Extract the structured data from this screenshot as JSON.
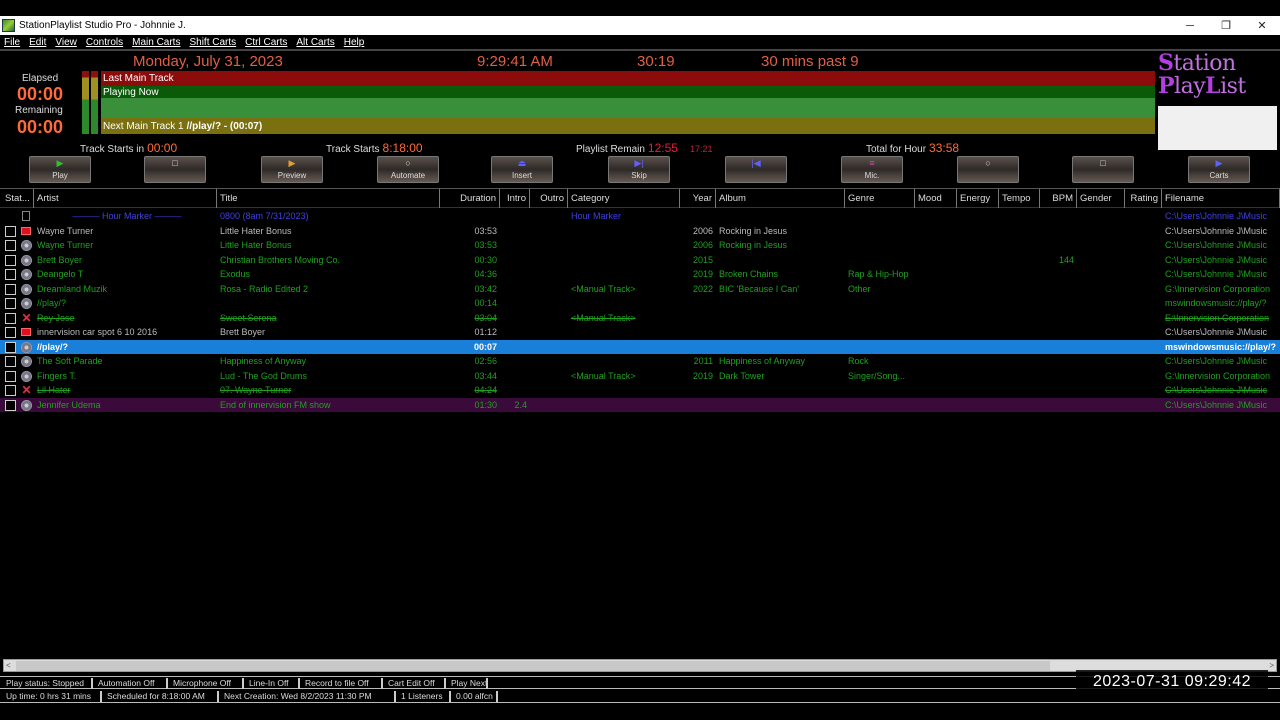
{
  "window": {
    "title": "StationPlaylist Studio Pro - Johnnie J.",
    "minimize_glyph": "─",
    "restore_glyph": "❐",
    "close_glyph": "✕"
  },
  "menu": [
    "File",
    "Edit",
    "View",
    "Controls",
    "Main Carts",
    "Shift Carts",
    "Ctrl Carts",
    "Alt Carts",
    "Help"
  ],
  "header": {
    "date": "Monday, July 31, 2023",
    "time": "9:29:41 AM",
    "countdown": "30:19",
    "mins_past": "30 mins past 9",
    "elapsed_label": "Elapsed",
    "elapsed_value": "00:00",
    "remaining_label": "Remaining",
    "remaining_value": "00:00"
  },
  "track_bars": {
    "last_main_track": "Last Main Track",
    "playing_now": "Playing Now",
    "next_label": "Next Main Track 1",
    "next_value": "//play/? -  (00:07)"
  },
  "logo": {
    "line1_cap": "S",
    "line1_rest": "tation",
    "line2_cap": "P",
    "line2_mid": "lay",
    "line2_cap2": "L",
    "line2_rest": "ist"
  },
  "info": {
    "track_starts_in_label": "Track Starts in",
    "track_starts_in_value": "00:00",
    "track_starts_label": "Track Starts",
    "track_starts_value": "8:18:00",
    "playlist_remain_label": "Playlist Remain",
    "playlist_remain_value": "12:55",
    "playlist_remain_secondary": "17:21",
    "total_for_hour_label": "Total for Hour",
    "total_for_hour_value": "33:58"
  },
  "toolbar": [
    {
      "name": "play",
      "label": "Play",
      "icon": "▶",
      "color": "#30c030"
    },
    {
      "name": "stop",
      "label": "",
      "icon": "□",
      "color": "#ddd"
    },
    {
      "name": "preview",
      "label": "Preview",
      "icon": "▶",
      "color": "#e0a030"
    },
    {
      "name": "automate",
      "label": "Automate",
      "icon": "○",
      "color": "#ddd"
    },
    {
      "name": "insert",
      "label": "Insert",
      "icon": "⏏",
      "color": "#6060ff"
    },
    {
      "name": "skip",
      "label": "Skip",
      "icon": "▶|",
      "color": "#6060ff"
    },
    {
      "name": "previous",
      "label": "",
      "icon": "|◀",
      "color": "#6060ff"
    },
    {
      "name": "mic",
      "label": "Mic.",
      "icon": "≡",
      "color": "#e040c0"
    },
    {
      "name": "record",
      "label": "",
      "icon": "○",
      "color": "#ddd"
    },
    {
      "name": "stop2",
      "label": "",
      "icon": "□",
      "color": "#ddd"
    },
    {
      "name": "carts",
      "label": "Carts",
      "icon": "▶",
      "color": "#6060ff"
    }
  ],
  "columns": [
    "Stat...",
    "Artist",
    "Title",
    "Duration",
    "Intro",
    "Outro",
    "Category",
    "Year",
    "Album",
    "Genre",
    "Mood",
    "Energy",
    "Tempo",
    "BPM",
    "Gender",
    "Rating",
    "Filename"
  ],
  "rows": [
    {
      "type": "hour-marker",
      "icon": "hour",
      "artist": "——— Hour Marker ———",
      "title": "0800 (8am 7/31/2023)",
      "duration": "",
      "intro": "",
      "category": "Hour Marker",
      "year": "",
      "album": "",
      "genre": "",
      "bpm": "",
      "filename": "C:\\Users\\Johnnie J\\Music",
      "color": "#4040e0",
      "checkbox": false
    },
    {
      "type": "normal",
      "icon": "red",
      "artist": "Wayne Turner",
      "title": "Little Hater Bonus",
      "duration": "03:53",
      "intro": "",
      "category": "",
      "year": "2006",
      "album": "Rocking in Jesus",
      "genre": "",
      "bpm": "",
      "filename": "C:\\Users\\Johnnie J\\Music",
      "color": "#bbbbbb",
      "checkbox": true
    },
    {
      "type": "normal",
      "icon": "cd",
      "artist": "Wayne Turner",
      "title": "Little Hater Bonus",
      "duration": "03:53",
      "intro": "",
      "category": "",
      "year": "2006",
      "album": "Rocking in Jesus",
      "genre": "",
      "bpm": "",
      "filename": "C:\\Users\\Johnnie J\\Music",
      "color": "#1fa01f",
      "checkbox": true
    },
    {
      "type": "normal",
      "icon": "cd",
      "artist": "Brett Boyer",
      "title": "Christian Brothers Moving Co.",
      "duration": "00:30",
      "intro": "",
      "category": "",
      "year": "2015",
      "album": "",
      "genre": "",
      "bpm": "144",
      "filename": "C:\\Users\\Johnnie J\\Music",
      "color": "#1fa01f",
      "checkbox": true
    },
    {
      "type": "normal",
      "icon": "cd",
      "artist": "Deangelo T",
      "title": "Exodus",
      "duration": "04:36",
      "intro": "",
      "category": "",
      "year": "2019",
      "album": "Broken Chains",
      "genre": "Rap & Hip-Hop",
      "bpm": "",
      "filename": "C:\\Users\\Johnnie J\\Music",
      "color": "#1fa01f",
      "checkbox": true
    },
    {
      "type": "normal",
      "icon": "cd",
      "artist": "Dreamland Muzik",
      "title": "Rosa - Radio Edited 2",
      "duration": "03:42",
      "intro": "",
      "category": "<Manual Track>",
      "year": "2022",
      "album": "BIC 'Because I Can'",
      "genre": "Other",
      "bpm": "",
      "filename": "G:\\Innervision Corporation",
      "color": "#1fa01f",
      "checkbox": true
    },
    {
      "type": "normal",
      "icon": "cd",
      "artist": "//play/?",
      "title": "",
      "duration": "00:14",
      "intro": "",
      "category": "",
      "year": "",
      "album": "",
      "genre": "",
      "bpm": "",
      "filename": "mswindowsmusic://play/?",
      "color": "#1fa01f",
      "checkbox": true
    },
    {
      "type": "strike",
      "icon": "x",
      "artist": "Rey Jose",
      "title": "Sweet Serena",
      "duration": "03:04",
      "intro": "",
      "category": "<Manual Track>",
      "year": "",
      "album": "",
      "genre": "",
      "bpm": "",
      "filename": "E:\\Innervision Corporation",
      "color": "#1fa01f",
      "checkbox": true
    },
    {
      "type": "normal",
      "icon": "red",
      "artist": "innervision car spot 6 10 2016",
      "title": "Brett Boyer",
      "duration": "01:12",
      "intro": "",
      "category": "",
      "year": "",
      "album": "",
      "genre": "",
      "bpm": "",
      "filename": "C:\\Users\\Johnnie J\\Music",
      "color": "#bbbbbb",
      "checkbox": true
    },
    {
      "type": "selected",
      "icon": "cd",
      "artist": "//play/?",
      "title": "",
      "duration": "00:07",
      "intro": "",
      "category": "",
      "year": "",
      "album": "",
      "genre": "",
      "bpm": "",
      "filename": "mswindowsmusic://play/?",
      "color": "#ffffff",
      "checkbox": true
    },
    {
      "type": "normal",
      "icon": "cd",
      "artist": "The Soft Parade",
      "title": "Happiness of Anyway",
      "duration": "02:56",
      "intro": "",
      "category": "",
      "year": "2011",
      "album": "Happiness of Anyway",
      "genre": "Rock",
      "bpm": "",
      "filename": "C:\\Users\\Johnnie J\\Music",
      "color": "#1fa01f",
      "checkbox": true
    },
    {
      "type": "normal",
      "icon": "cd",
      "artist": "Fingers T.",
      "title": "Lud - The God Drums",
      "duration": "03:44",
      "intro": "",
      "category": "<Manual Track>",
      "year": "2019",
      "album": "Dark Tower",
      "genre": "Singer/Song...",
      "bpm": "",
      "filename": "G:\\Innervision Corporation",
      "color": "#1fa01f",
      "checkbox": true
    },
    {
      "type": "strike",
      "icon": "x",
      "artist": "Lil Hater",
      "title": "07. Wayne Turner",
      "duration": "04:24",
      "intro": "",
      "category": "",
      "year": "",
      "album": "",
      "genre": "",
      "bpm": "",
      "filename": "C:\\Users\\Johnnie J\\Music",
      "color": "#1fa01f",
      "checkbox": true
    },
    {
      "type": "purple",
      "icon": "cd",
      "artist": "Jennifer Udema",
      "title": "End of innervision FM show",
      "duration": "01:30",
      "intro": "2.4",
      "category": "",
      "year": "",
      "album": "",
      "genre": "",
      "bpm": "",
      "filename": "C:\\Users\\Johnnie J\\Music",
      "color": "#1fa01f",
      "checkbox": true
    }
  ],
  "status_bar_1": [
    "Play status: Stopped",
    "Automation Off",
    "Microphone Off",
    "Line-In Off",
    "Record to file Off",
    "Cart Edit Off",
    "Play Next"
  ],
  "status_bar_2": [
    "Up time: 0 hrs 31 mins",
    "Scheduled for 8:18:00 AM",
    "Next Creation: Wed 8/2/2023 11:30 PM",
    "1 Listeners",
    "0.00 alfcn"
  ],
  "overlay_timestamp": "2023-07-31  09:29:42"
}
